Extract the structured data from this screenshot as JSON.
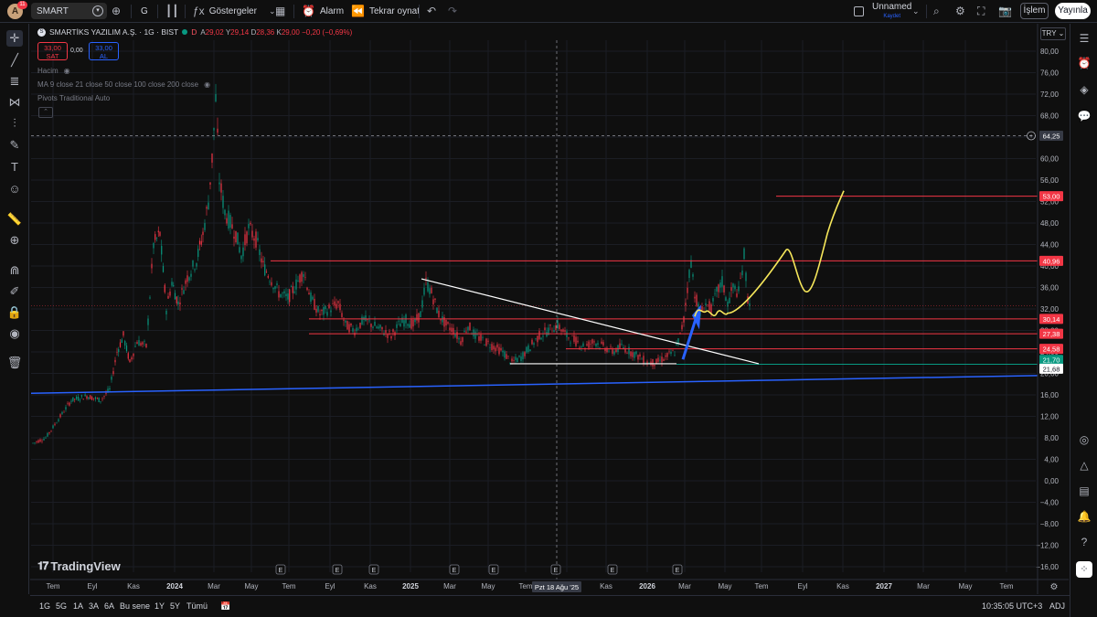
{
  "topbar": {
    "avatar_letter": "A",
    "notifications": "11",
    "symbol": "SMART",
    "interval": "G",
    "indicators_label": "Göstergeler",
    "alarm_label": "Alarm",
    "replay_label": "Tekrar oynat",
    "layout_name": "Unnamed",
    "layout_status": "Kaydet",
    "trade_label": "İşlem",
    "publish_label": "Yayınla"
  },
  "legend": {
    "title": "SMARTİKS YAZILIM A.Ş. · 1G · BIST",
    "logo_glyph": "S",
    "delay_badge": "D",
    "open_label": "A",
    "open": "29,02",
    "high_label": "Y",
    "high": "29,14",
    "low_label": "D",
    "low": "28,36",
    "close_label": "K",
    "close": "29,00",
    "change": "−0,20 (−0,69%)",
    "sell_price": "33,00",
    "sell_label": "SAT",
    "spread": "0,00",
    "buy_price": "33,00",
    "buy_label": "AL",
    "indicators": [
      "Hacim",
      "MA 9 close 21 close 50 close 100 close 200 close",
      "Pivots Traditional Auto"
    ],
    "currency": "TRY"
  },
  "chart_data": {
    "type": "candlestick",
    "symbol": "SMART",
    "interval": "1G",
    "exchange": "BIST",
    "currency": "TRY",
    "y_ticks": [
      "80,00",
      "76,00",
      "72,00",
      "68,00",
      "64,00",
      "60,00",
      "56,00",
      "52,00",
      "48,00",
      "44,00",
      "40,00",
      "36,00",
      "32,00",
      "28,00",
      "24,00",
      "20,00",
      "16,00",
      "12,00",
      "8,00",
      "4,00",
      "0,00",
      "−4,00",
      "−8,00",
      "−12,00",
      "−16,00"
    ],
    "y_range": [
      -18,
      82
    ],
    "x_ticks": [
      "Tem",
      "Eyl",
      "Kas",
      "2024",
      "Mar",
      "May",
      "Tem",
      "Eyl",
      "Kas",
      "2025",
      "Mar",
      "May",
      "Tem",
      "Eyl",
      "Kas",
      "2026",
      "Mar",
      "May",
      "Tem",
      "Eyl",
      "Kas",
      "2027",
      "Mar",
      "May",
      "Tem"
    ],
    "crosshair_date": "Pzt 18 Ağu '25",
    "crosshair_price": "64,25",
    "price_labels": [
      {
        "value": "53,00",
        "kind": "resistance",
        "color": "#f23645"
      },
      {
        "value": "40,96",
        "kind": "resistance",
        "color": "#f23645"
      },
      {
        "value": "30,14",
        "kind": "level",
        "color": "#f23645"
      },
      {
        "value": "27,38",
        "kind": "level",
        "color": "#f23645"
      },
      {
        "value": "24,58",
        "kind": "level",
        "color": "#f23645"
      },
      {
        "value": "21,70",
        "kind": "support",
        "color": "#089981"
      },
      {
        "value": "21,68",
        "kind": "last-price",
        "color": "#ffffff"
      }
    ],
    "horizontal_levels": [
      53.0,
      40.96,
      30.14,
      27.38,
      24.58,
      21.7
    ],
    "trendlines": [
      {
        "name": "descending-white",
        "from": [
          "Tem 2024",
          37.6
        ],
        "to": [
          "Mar 2026",
          22.0
        ],
        "color": "#ffffff"
      },
      {
        "name": "ascending-blue",
        "from": [
          "Haz 2023",
          16.3
        ],
        "to": [
          "Tem 2027",
          19.8
        ],
        "color": "#2962ff"
      }
    ],
    "earnings_markers": [
      "E",
      "E",
      "E",
      "E",
      "E",
      "E",
      "E",
      "E",
      "E"
    ],
    "grid": true,
    "projection_color": "#f5e65a"
  },
  "watermark": "TradingView",
  "bottombar": {
    "timeframes": [
      "1G",
      "5G",
      "1A",
      "3A",
      "6A",
      "Bu sene",
      "1Y",
      "5Y",
      "Tümü"
    ],
    "clock": "10:35:05 UTC+3",
    "adj_label": "ADJ"
  }
}
